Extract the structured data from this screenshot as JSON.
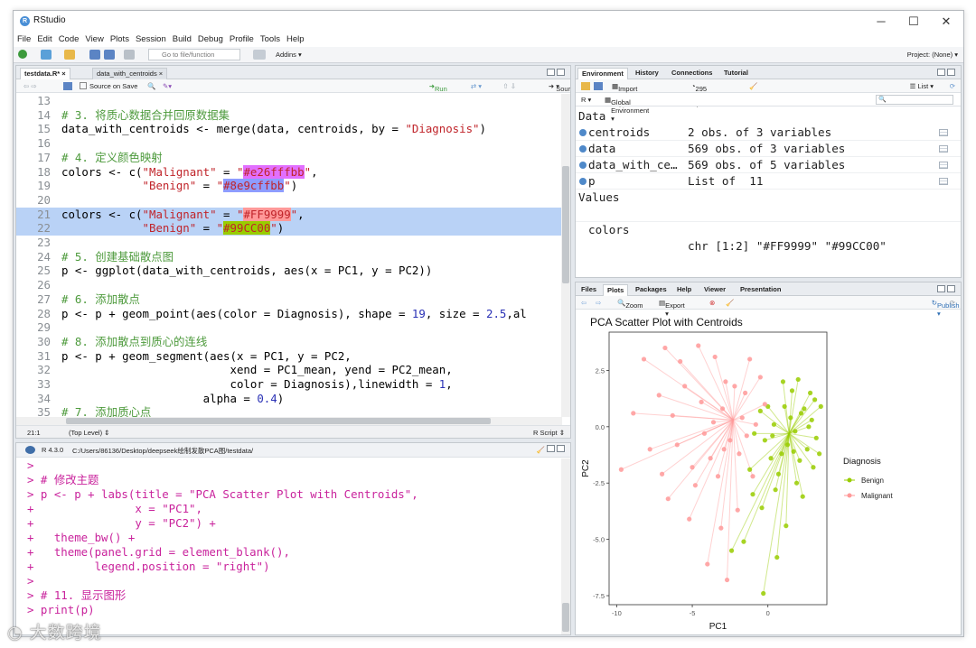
{
  "window": {
    "title": "RStudio",
    "controls": [
      "─",
      "☐",
      "✕"
    ]
  },
  "menu": [
    "File",
    "Edit",
    "Code",
    "View",
    "Plots",
    "Session",
    "Build",
    "Debug",
    "Profile",
    "Tools",
    "Help"
  ],
  "toolbar": {
    "goto_placeholder": "Go to file/function",
    "addins_label": "Addins ▾",
    "project_label": "Project: (None) ▾"
  },
  "editor": {
    "tabs": [
      {
        "label": "testdata.R*",
        "active": true
      },
      {
        "label": "data_with_centroids",
        "active": false
      }
    ],
    "source_on_save": "Source on Save",
    "run_label": "Run",
    "source_label": "Source",
    "lines": [
      {
        "num": "13",
        "html": ""
      },
      {
        "num": "14",
        "html": "<span class=\"cmt\"># 3. 将质心数据合并回原数据集</span>"
      },
      {
        "num": "15",
        "html": "data_with_centroids &lt;- merge(data, centroids, by = <span class=\"str\">\"Diagnosis\"</span>)"
      },
      {
        "num": "16",
        "html": ""
      },
      {
        "num": "17",
        "html": "<span class=\"cmt\"># 4. 定义颜色映射</span>"
      },
      {
        "num": "18",
        "html": "colors &lt;- c(<span class=\"str\">\"Malignant\"</span> = <span class=\"str\">\"<span style=\"background:#e26fff\">#e26fffbb</span>\"</span>,"
      },
      {
        "num": "19",
        "html": "            <span class=\"str\">\"Benign\"</span> = <span class=\"str\">\"<span style=\"background:#8e9cff\">#8e9cffbb</span>\"</span>)"
      },
      {
        "num": "20",
        "html": ""
      },
      {
        "num": "21",
        "html": "colors &lt;- c(<span class=\"str\">\"Malignant\"</span> = <span class=\"str\">\"<span style=\"background:#FF9999\">#FF9999</span>\"</span>,",
        "sel": true
      },
      {
        "num": "22",
        "html": "            <span class=\"str\">\"Benign\"</span> = <span class=\"str\">\"<span style=\"background:#99CC00\">#99CC00</span>\"</span>)",
        "sel": true
      },
      {
        "num": "23",
        "html": ""
      },
      {
        "num": "24",
        "html": "<span class=\"cmt\"># 5. 创建基础散点图</span>"
      },
      {
        "num": "25",
        "html": "p &lt;- ggplot(data_with_centroids, aes(x = PC1, y = PC2))"
      },
      {
        "num": "26",
        "html": ""
      },
      {
        "num": "27",
        "html": "<span class=\"cmt\"># 6. 添加散点</span>"
      },
      {
        "num": "28",
        "html": "p &lt;- p + geom_point(aes(color = Diagnosis), shape = <span class=\"num\">19</span>, size = <span class=\"num\">2.5</span>,al"
      },
      {
        "num": "29",
        "html": ""
      },
      {
        "num": "30",
        "html": "<span class=\"cmt\"># 8. 添加散点到质心的连线</span>"
      },
      {
        "num": "31",
        "html": "p &lt;- p + geom_segment(aes(x = PC1, y = PC2,"
      },
      {
        "num": "32",
        "html": "                         xend = PC1_mean, yend = PC2_mean,"
      },
      {
        "num": "33",
        "html": "                         color = Diagnosis),linewidth = <span class=\"num\">1</span>,"
      },
      {
        "num": "34",
        "html": "                     alpha = <span class=\"num\">0.4</span>)"
      },
      {
        "num": "35",
        "html": "<span class=\"cmt\"># 7. 添加质心点</span>"
      },
      {
        "num": "36",
        "html": ""
      }
    ],
    "status_pos": "21:1",
    "status_level": "(Top Level) ⇕",
    "status_type": "R Script ⇕"
  },
  "console": {
    "header_r": "R 4.3.0",
    "header_path": "C:/Users/86136/Desktop/deepseek绘制发散PCA图/testdata/",
    "lines": [
      "> ",
      "> # 修改主题",
      "> p <- p + labs(title = \"PCA Scatter Plot with Centroids\",",
      "+               x = \"PC1\",",
      "+               y = \"PC2\") +",
      "+   theme_bw() +",
      "+   theme(panel.grid = element_blank(),",
      "+         legend.position = \"right\")",
      "> ",
      "> # 11. 显示图形",
      "> print(p)",
      "> "
    ]
  },
  "environment": {
    "tabs": [
      "Environment",
      "History",
      "Connections",
      "Tutorial"
    ],
    "import_label": "Import Dataset ▾",
    "memory": "295 MiB ▾",
    "list_label": "☰ List ▾",
    "lang": "R ▾",
    "scope": "Global Environment ▾",
    "data_heading": "Data",
    "values_heading": "Values",
    "rows": [
      {
        "name": "centroids",
        "value": "2 obs. of 3 variables"
      },
      {
        "name": "data",
        "value": "569 obs. of 3 variables"
      },
      {
        "name": "data_with_ce…",
        "value": "569 obs. of 5 variables"
      },
      {
        "name": "p",
        "value": "List of  11"
      }
    ],
    "values": [
      {
        "name": "colors",
        "value": "chr [1:2] \"#FF9999\" \"#99CC00\""
      }
    ]
  },
  "files": {
    "tabs": [
      "Files",
      "Plots",
      "Packages",
      "Help",
      "Viewer",
      "Presentation"
    ],
    "zoom_label": "Zoom",
    "export_label": "Export ▾",
    "publish_label": "Publish ▾"
  },
  "chart_data": {
    "type": "scatter",
    "title": "PCA Scatter Plot with Centroids",
    "xlabel": "PC1",
    "ylabel": "PC2",
    "xlim": [
      -10.5,
      3.9
    ],
    "ylim": [
      -7.9,
      4.2
    ],
    "x_ticks": [
      -10,
      -5,
      0
    ],
    "y_ticks": [
      2.5,
      0.0,
      -2.5,
      -5.0,
      -7.5
    ],
    "y_tick_labels": [
      "2.5",
      "0.0",
      "-2.5",
      "-5.0",
      "-7.5"
    ],
    "grid": false,
    "legend": {
      "title": "Diagnosis",
      "position": "right"
    },
    "series": [
      {
        "name": "Benign",
        "color": "#99CC00",
        "centroid": [
          1.4,
          -0.3
        ],
        "points": [
          [
            1.8,
            -0.2
          ],
          [
            2.4,
            0.8
          ],
          [
            0.9,
            -1.2
          ],
          [
            2.9,
            0.3
          ],
          [
            1.1,
            0.9
          ],
          [
            3.2,
            -0.5
          ],
          [
            0.4,
            0.1
          ],
          [
            2.1,
            -1.5
          ],
          [
            1.6,
            1.6
          ],
          [
            -0.2,
            -0.6
          ],
          [
            2.6,
            -1.0
          ],
          [
            0.7,
            -2.1
          ],
          [
            3.5,
            0.9
          ],
          [
            1.3,
            -0.8
          ],
          [
            -0.5,
            0.7
          ],
          [
            2.0,
            2.1
          ],
          [
            0.2,
            -1.4
          ],
          [
            3.0,
            -1.8
          ],
          [
            1.5,
            0.4
          ],
          [
            -0.9,
            -0.3
          ],
          [
            2.8,
            1.5
          ],
          [
            0.5,
            -2.8
          ],
          [
            1.9,
            -2.5
          ],
          [
            -1.2,
            -1.9
          ],
          [
            3.4,
            -1.2
          ],
          [
            1.0,
            2.0
          ],
          [
            -0.4,
            -3.6
          ],
          [
            2.3,
            -3.1
          ],
          [
            -1.6,
            -5.1
          ],
          [
            -0.3,
            -7.4
          ],
          [
            0.6,
            -5.8
          ],
          [
            -2.4,
            -5.5
          ],
          [
            1.2,
            -4.4
          ],
          [
            -1.0,
            -3.0
          ],
          [
            2.7,
            0.0
          ],
          [
            0.0,
            0.9
          ],
          [
            1.7,
            -1.1
          ],
          [
            3.1,
            1.2
          ],
          [
            0.3,
            -0.4
          ],
          [
            2.2,
            0.6
          ]
        ]
      },
      {
        "name": "Malignant",
        "color": "#FF9999",
        "centroid": [
          -2.3,
          0.3
        ],
        "points": [
          [
            -3.0,
            0.8
          ],
          [
            -1.5,
            1.5
          ],
          [
            -4.2,
            -0.3
          ],
          [
            -2.8,
            2.0
          ],
          [
            -0.8,
            0.1
          ],
          [
            -5.5,
            1.8
          ],
          [
            -6.8,
            3.5
          ],
          [
            -7.2,
            1.4
          ],
          [
            -9.7,
            -1.9
          ],
          [
            -8.2,
            3.0
          ],
          [
            -6.0,
            -0.8
          ],
          [
            -4.8,
            -2.6
          ],
          [
            -3.5,
            3.1
          ],
          [
            -1.2,
            3.0
          ],
          [
            -0.5,
            2.2
          ],
          [
            -5.2,
            -4.1
          ],
          [
            -3.3,
            -2.2
          ],
          [
            -2.0,
            -3.7
          ],
          [
            -4.0,
            -6.1
          ],
          [
            -2.7,
            -6.8
          ],
          [
            -6.6,
            -3.2
          ],
          [
            -7.8,
            -1.0
          ],
          [
            -5.8,
            2.9
          ],
          [
            -4.4,
            1.1
          ],
          [
            -3.8,
            -1.4
          ],
          [
            -1.9,
            -1.2
          ],
          [
            -2.5,
            -0.6
          ],
          [
            -1.0,
            -2.2
          ],
          [
            -0.2,
            1.0
          ],
          [
            -1.7,
            0.4
          ],
          [
            -8.9,
            0.6
          ],
          [
            -6.3,
            0.5
          ],
          [
            -4.6,
            3.6
          ],
          [
            -3.1,
            -4.5
          ],
          [
            -5.0,
            -1.8
          ],
          [
            -2.2,
            1.8
          ],
          [
            -3.6,
            0.2
          ],
          [
            -7.0,
            -2.1
          ],
          [
            -1.4,
            -0.4
          ],
          [
            -2.9,
            -1.0
          ]
        ]
      }
    ]
  },
  "watermark": "大数跨境"
}
